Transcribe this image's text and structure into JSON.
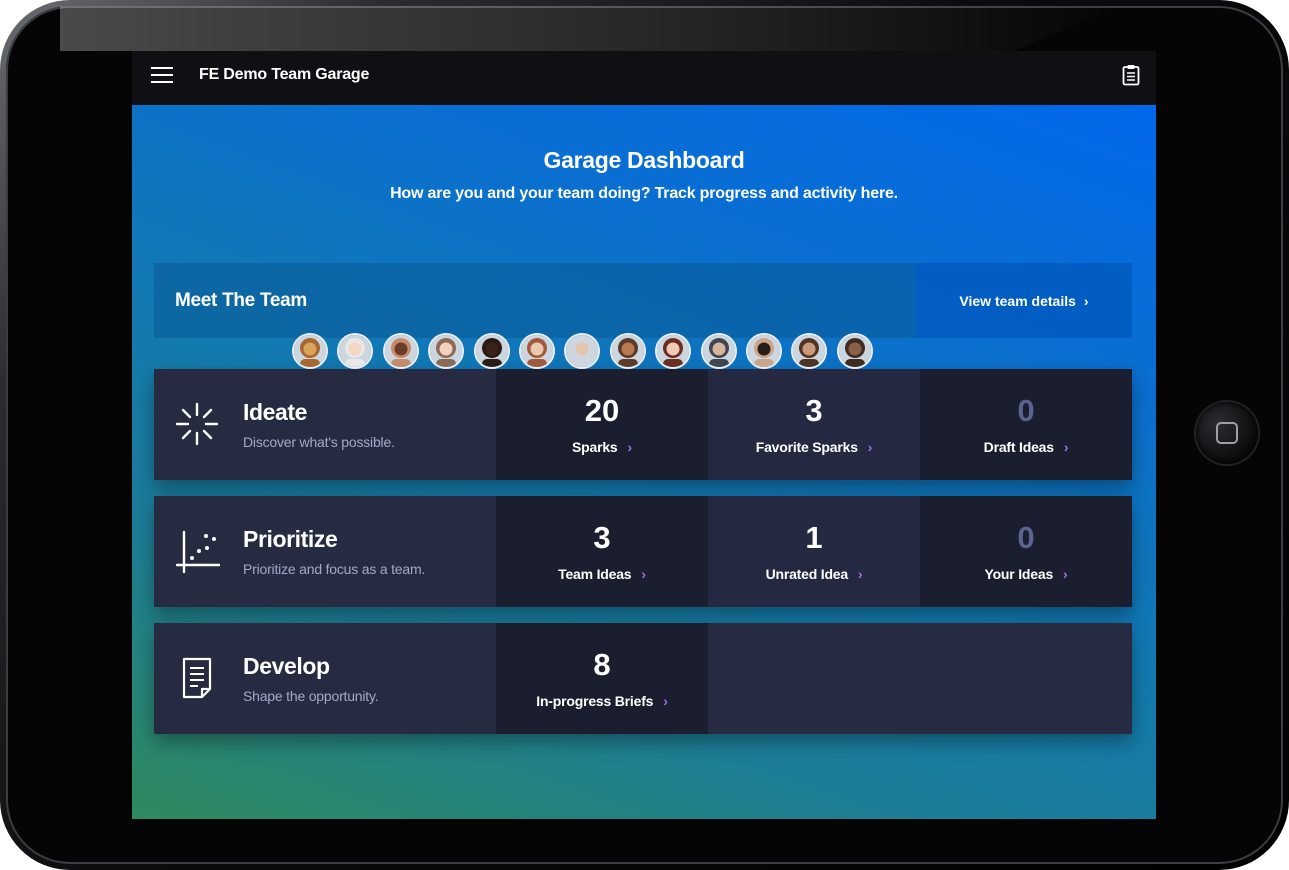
{
  "app": {
    "title": "FE Demo Team Garage"
  },
  "hero": {
    "title": "Garage Dashboard",
    "subtitle": "How are you and your team doing? Track progress and activity here."
  },
  "team": {
    "title": "Meet The Team",
    "link_label": "View team details",
    "member_count": 13
  },
  "rows": [
    {
      "title": "Ideate",
      "description": "Discover what's possible.",
      "icon": "spark-burst-icon",
      "stats": [
        {
          "value": "20",
          "label": "Sparks"
        },
        {
          "value": "3",
          "label": "Favorite Sparks"
        },
        {
          "value": "0",
          "label": "Draft Ideas"
        }
      ]
    },
    {
      "title": "Prioritize",
      "description": "Prioritize and focus as a team.",
      "icon": "scatter-chart-icon",
      "stats": [
        {
          "value": "3",
          "label": "Team Ideas"
        },
        {
          "value": "1",
          "label": "Unrated Idea"
        },
        {
          "value": "0",
          "label": "Your Ideas"
        }
      ]
    },
    {
      "title": "Develop",
      "description": "Shape the opportunity.",
      "icon": "document-icon",
      "stats": [
        {
          "value": "8",
          "label": "In-progress Briefs"
        }
      ]
    }
  ],
  "colors": {
    "accent_chevron": "#a86cf0",
    "topbar": "#0e1013",
    "card": "#262b42",
    "stat_dark": "#1b1e2f",
    "zero_value": "#5a6492"
  }
}
